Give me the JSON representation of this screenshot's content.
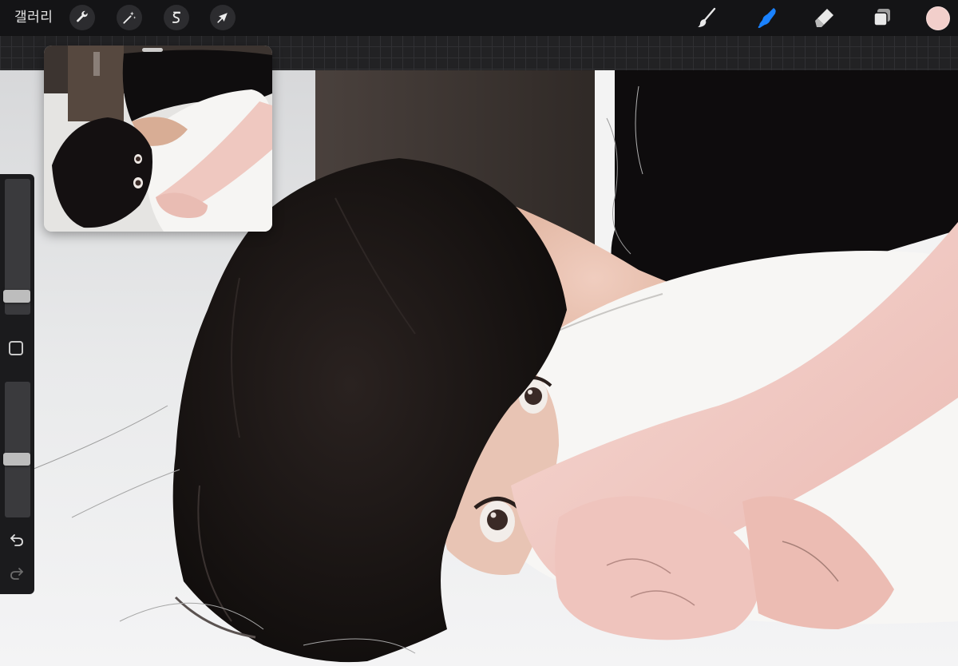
{
  "toolbar": {
    "gallery_label": "갤러리",
    "left_tools": [
      {
        "name": "actions",
        "icon": "wrench-icon"
      },
      {
        "name": "adjustments",
        "icon": "magic-wand-icon"
      },
      {
        "name": "selection",
        "icon": "selection-s-icon"
      },
      {
        "name": "transform",
        "icon": "arrow-cursor-icon"
      }
    ],
    "right_tools": [
      {
        "name": "brush",
        "icon": "paintbrush-icon",
        "active": false
      },
      {
        "name": "smudge",
        "icon": "smudge-finger-icon",
        "active": true
      },
      {
        "name": "eraser",
        "icon": "eraser-icon",
        "active": false
      },
      {
        "name": "layers",
        "icon": "layers-icon",
        "active": false
      }
    ],
    "current_color": "#f2cfcb",
    "active_tool_color": "#1a82ff"
  },
  "sidebar": {
    "brush_size_level": 0.1,
    "opacity_level": 0.42,
    "undo_icon": "undo-icon",
    "redo_icon": "redo-icon",
    "modify_icon": "square-modify-icon"
  },
  "reference": {
    "icon": "reference-photo"
  }
}
